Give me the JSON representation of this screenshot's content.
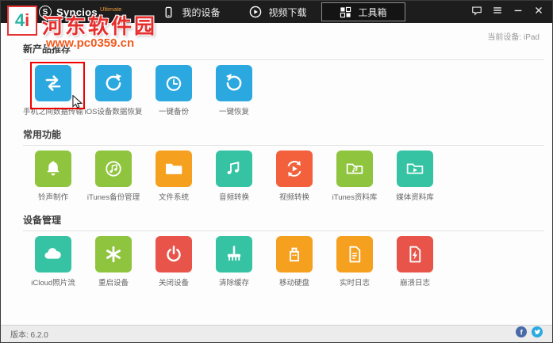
{
  "titlebar": {
    "logo_letter": "S",
    "app_name": "Syncios",
    "app_edition": "Ultimate",
    "tabs": [
      {
        "id": "my-devices",
        "label": "我的设备",
        "icon": "phone",
        "active": false
      },
      {
        "id": "video-download",
        "label": "视频下载",
        "icon": "play",
        "active": false
      },
      {
        "id": "toolbox",
        "label": "工具箱",
        "icon": "grid",
        "active": true
      }
    ],
    "controls": [
      {
        "id": "feedback",
        "icon": "chat"
      },
      {
        "id": "menu",
        "icon": "menu"
      },
      {
        "id": "minimize",
        "icon": "minimize"
      },
      {
        "id": "close",
        "icon": "close"
      }
    ]
  },
  "header": {
    "current_device": "当前设备: iPad"
  },
  "sections": [
    {
      "title": "新产品推荐",
      "items": [
        {
          "id": "phone-transfer",
          "label": "手机之间数据传输",
          "icon": "transfer",
          "color": "#2ba8e0"
        },
        {
          "id": "ios-recovery",
          "label": "iOS设备数据恢复",
          "icon": "recover",
          "color": "#2ba8e0"
        },
        {
          "id": "one-key-backup",
          "label": "一键备份",
          "icon": "backup",
          "color": "#2ba8e0"
        },
        {
          "id": "one-key-restore",
          "label": "一键恢复",
          "icon": "restore",
          "color": "#2ba8e0"
        }
      ]
    },
    {
      "title": "常用功能",
      "items": [
        {
          "id": "ringtone-maker",
          "label": "铃声制作",
          "icon": "bell",
          "color": "#8fc43e"
        },
        {
          "id": "itunes-backup",
          "label": "iTunes备份管理",
          "icon": "itunes-backup",
          "color": "#8fc43e"
        },
        {
          "id": "file-system",
          "label": "文件系统",
          "icon": "folder",
          "color": "#f6a01f"
        },
        {
          "id": "audio-convert",
          "label": "音频转换",
          "icon": "audio",
          "color": "#35c3a3"
        },
        {
          "id": "video-convert",
          "label": "视频转换",
          "icon": "video-convert",
          "color": "#f2603c"
        },
        {
          "id": "itunes-library",
          "label": "iTunes资料库",
          "icon": "itunes-lib",
          "color": "#8fc43e"
        },
        {
          "id": "media-library",
          "label": "媒体资料库",
          "icon": "media-lib",
          "color": "#35c3a3"
        }
      ]
    },
    {
      "title": "设备管理",
      "items": [
        {
          "id": "icloud-photos",
          "label": "iCloud照片流",
          "icon": "cloud",
          "color": "#35c3a3"
        },
        {
          "id": "reboot-device",
          "label": "重启设备",
          "icon": "restart",
          "color": "#8fc43e"
        },
        {
          "id": "shutdown-device",
          "label": "关闭设备",
          "icon": "power",
          "color": "#e8544a"
        },
        {
          "id": "clear-cache",
          "label": "清除缓存",
          "icon": "clean",
          "color": "#35c3a3"
        },
        {
          "id": "mobile-disk",
          "label": "移动硬盘",
          "icon": "usb",
          "color": "#f6a01f"
        },
        {
          "id": "realtime-log",
          "label": "实时日志",
          "icon": "log",
          "color": "#f6a01f"
        },
        {
          "id": "crash-log",
          "label": "崩溃日志",
          "icon": "crash",
          "color": "#e8544a"
        }
      ]
    }
  ],
  "statusbar": {
    "version_label": "版本: 6.2.0",
    "social": [
      {
        "id": "facebook",
        "icon": "facebook",
        "color": "#4a69a8"
      },
      {
        "id": "twitter",
        "icon": "twitter",
        "color": "#2aa9e0"
      }
    ]
  },
  "watermark": {
    "logo_parts": [
      "4",
      "i"
    ],
    "site_name": "河东软件园",
    "site_url": "www.pc0359.cn"
  }
}
